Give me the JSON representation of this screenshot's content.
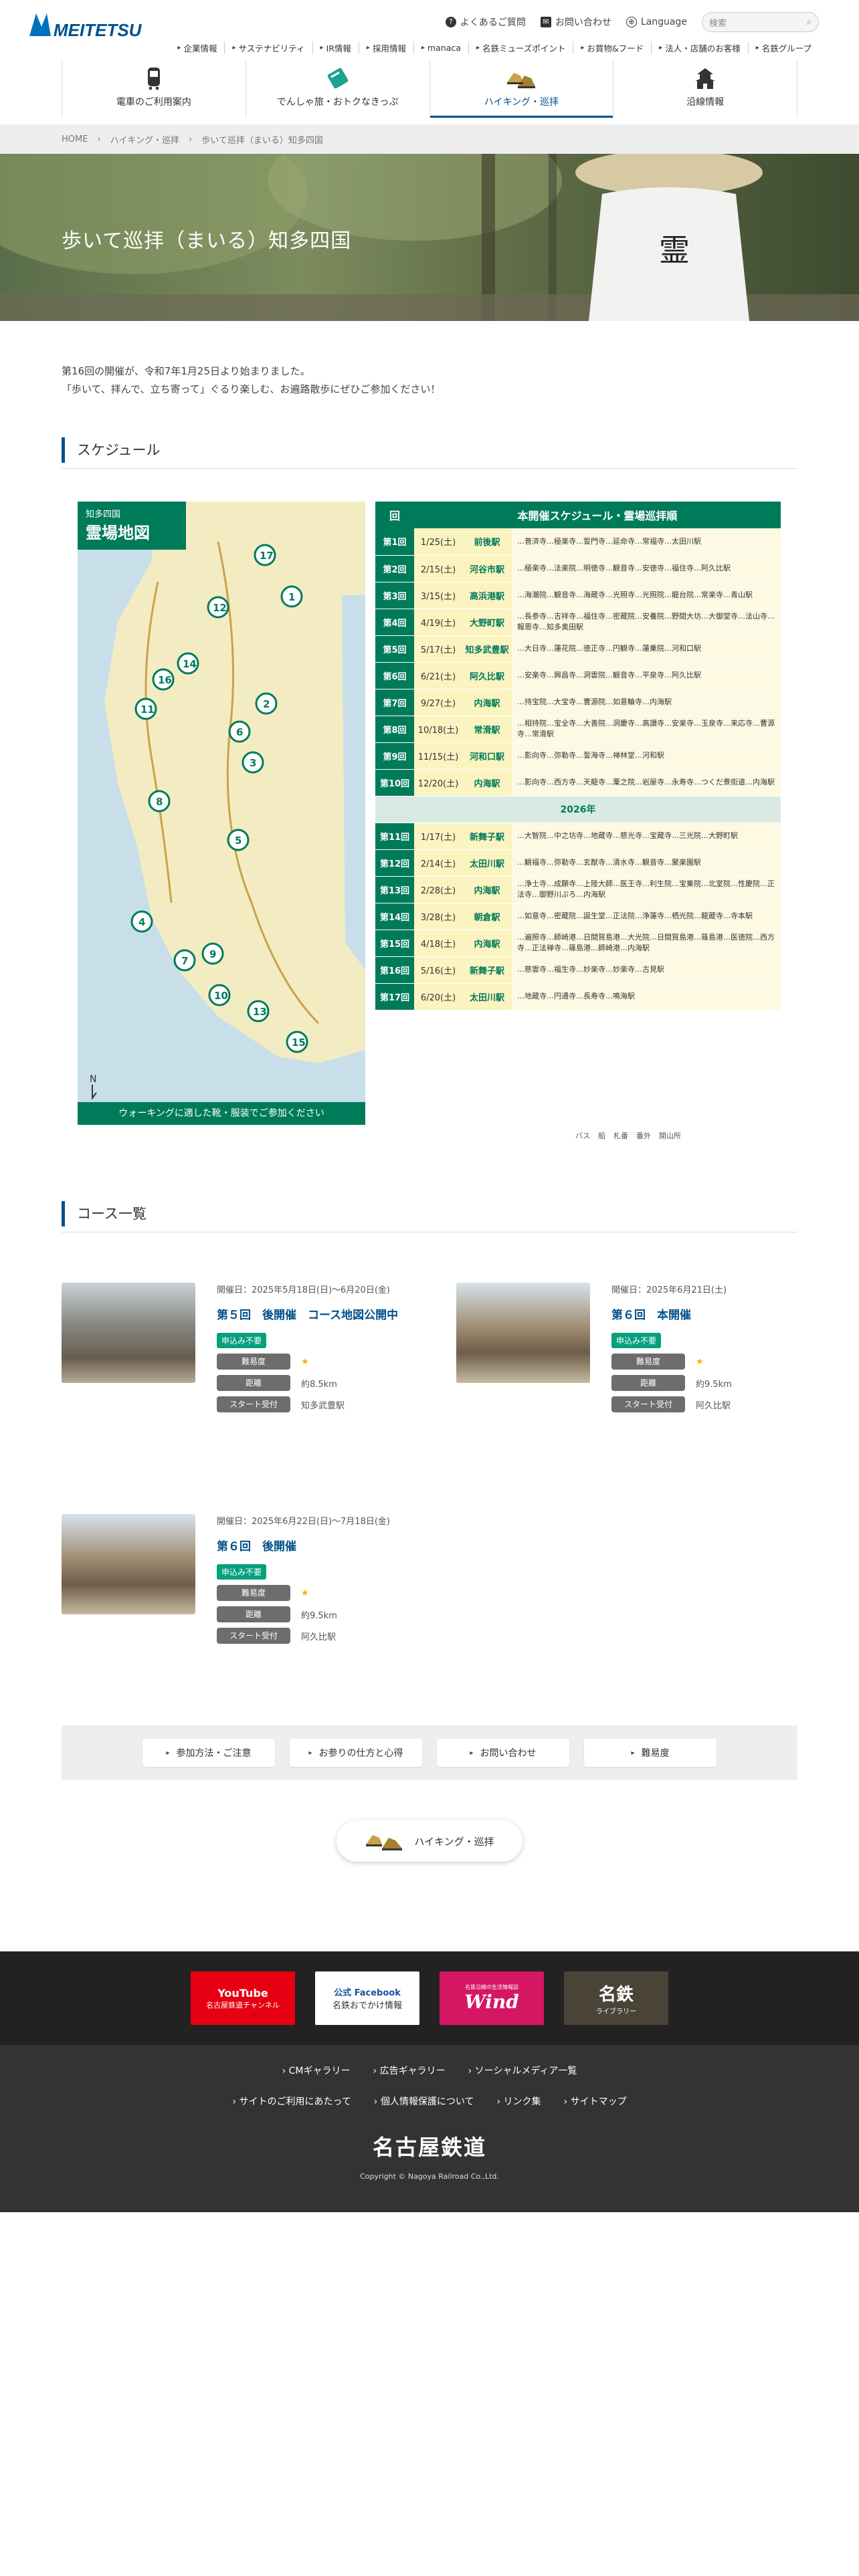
{
  "header": {
    "logo_text": "MEITETSU",
    "util": [
      {
        "icon": "question-icon",
        "label": "よくあるご質問"
      },
      {
        "icon": "mail-icon",
        "label": "お問い合わせ"
      },
      {
        "icon": "globe-icon",
        "label": "Language"
      }
    ],
    "search_placeholder": "検索",
    "sublinks": [
      "企業情報",
      "サステナビリティ",
      "IR情報",
      "採用情報",
      "manaca",
      "名鉄ミューズポイント",
      "お買物&フード",
      "法人・店舗のお客様",
      "名鉄グループ"
    ],
    "gnav": [
      {
        "label": "電車のご利用案内",
        "icon": "train-icon"
      },
      {
        "label": "でんしゃ旅・おトクなきっぷ",
        "icon": "ticket-icon"
      },
      {
        "label": "ハイキング・巡拝",
        "icon": "shoes-icon"
      },
      {
        "label": "沿線情報",
        "icon": "castle-icon"
      }
    ]
  },
  "breadcrumb": [
    "HOME",
    "ハイキング・巡拝",
    "歩いて巡拝（まいる）知多四国"
  ],
  "hero_title": "歩いて巡拝（まいる）知多四国",
  "intro": [
    "第16回の開催が、令和7年1月25日より始まりました。",
    "「歩いて、拝んで、立ち寄って」ぐるり楽しむ、お遍路散歩にぜひご参加ください！"
  ],
  "schedule": {
    "section_title": "スケジュール",
    "map_title_1": "知多四国",
    "map_title_2": "霊場地図",
    "map_footer": "ウォーキングに適した靴・服装でご参加ください",
    "table_head_no": "回",
    "table_head_title": "本開催スケジュール・霊場巡拝順",
    "year_row": "2026年",
    "rows": [
      {
        "no": "第1回",
        "date": "1/25(土)",
        "station": "前後駅",
        "route": "…普済寺…極楽寺…誓門寺…延命寺…常福寺…太田川駅"
      },
      {
        "no": "第2回",
        "date": "2/15(土)",
        "station": "河谷市駅",
        "route": "…極楽寺…法楽院…明徳寺…観音寺…安徳寺…福住寺…阿久比駅"
      },
      {
        "no": "第3回",
        "date": "3/15(土)",
        "station": "高浜港駅",
        "route": "…海潮院…観音寺…海蔵寺…光照寺…光照院…龍台院…常楽寺…青山駅"
      },
      {
        "no": "第4回",
        "date": "4/19(土)",
        "station": "大野町駅",
        "route": "…長参寺…吉祥寺…福住寺…密蔵院…安養院…野間大坊…大御堂寺…法山寺…報恩寺…知多奥田駅"
      },
      {
        "no": "第5回",
        "date": "5/17(土)",
        "station": "知多武豊駅",
        "route": "…大日寺…蓮花院…徳正寺…円観寺…蓮乗院…河和口駅"
      },
      {
        "no": "第6回",
        "date": "6/21(土)",
        "station": "阿久比駅",
        "route": "…安楽寺…興昌寺…洞雲院…観音寺…平泉寺…阿久比駅"
      },
      {
        "no": "第7回",
        "date": "9/27(土)",
        "station": "内海駅",
        "route": "…持宝院…大宝寺…曹源院…如意輪寺…内海駅"
      },
      {
        "no": "第8回",
        "date": "10/18(土)",
        "station": "常滑駅",
        "route": "…相持院…宝全寺…大善院…洞慶寺…高讃寺…安楽寺…玉泉寺…来応寺…曹源寺…常滑駅"
      },
      {
        "no": "第9回",
        "date": "11/15(土)",
        "station": "河和口駅",
        "route": "…影向寺…弥勒寺…誓海寺…禅林堂…河和駅"
      },
      {
        "no": "第10回",
        "date": "12/20(土)",
        "station": "内海駅",
        "route": "…影向寺…西方寺…天龍寺…粟之院…岩屋寺…永寿寺…つくだ煮街道…内海駅"
      },
      {
        "no": "第11回",
        "date": "1/17(土)",
        "station": "新舞子駅",
        "route": "…大智院…中之坊寺…地蔵寺…慈光寺…宝蔵寺…三光院…大野町駅"
      },
      {
        "no": "第12回",
        "date": "2/14(土)",
        "station": "太田川駅",
        "route": "…観福寺…弥勒寺…玄猷寺…清水寺…観音寺…聚楽園駅"
      },
      {
        "no": "第13回",
        "date": "2/28(土)",
        "station": "内海駅",
        "route": "…浄土寺…成願寺…上陸大師…医王寺…利生院…宝乗院…北室院…性慶院…正法寺…御野川ぷろ…内海駅"
      },
      {
        "no": "第14回",
        "date": "3/28(土)",
        "station": "朝倉駅",
        "route": "…如意寺…密蔵院…誕生堂…正法院…浄蓮寺…栖光院…龍蔵寺…寺本駅"
      },
      {
        "no": "第15回",
        "date": "4/18(土)",
        "station": "内海駅",
        "route": "…遍照寺…師崎港…日間賀島港…大光院…日間賀島港…篠島港…医徳院…西方寺…正法禅寺…篠島港…師崎港…内海駅"
      },
      {
        "no": "第16回",
        "date": "5/16(土)",
        "station": "新舞子駅",
        "route": "…慈雲寺…福生寺…妙楽寺…妙楽寺…古見駅"
      },
      {
        "no": "第17回",
        "date": "6/20(土)",
        "station": "太田川駅",
        "route": "…地蔵寺…円通寺…長寿寺…鳴海駅"
      }
    ],
    "legend": [
      "バス",
      "船",
      "札番",
      "番外",
      "開山所"
    ]
  },
  "courses": {
    "section_title": "コース一覧",
    "label_difficulty": "難易度",
    "label_distance": "距離",
    "label_start": "スタート受付",
    "items": [
      {
        "date": "開催日：2025年5月18日(日)〜6月20日(金)",
        "title": "第５回　後開催　コース地図公開中",
        "badge": "申込み不要",
        "stars": "★",
        "distance": "約8.5km",
        "start": "知多武豊駅"
      },
      {
        "date": "開催日：2025年6月21日(土)",
        "title": "第６回　本開催",
        "badge": "申込み不要",
        "stars": "★",
        "distance": "約9.5km",
        "start": "阿久比駅"
      },
      {
        "date": "開催日：2025年6月22日(日)〜7月18日(金)",
        "title": "第６回　後開催",
        "badge": "申込み不要",
        "stars": "★",
        "distance": "約9.5km",
        "start": "阿久比駅"
      }
    ]
  },
  "bottom_links": [
    "参加方法・ご注意",
    "お参りの仕方と心得",
    "お問い合わせ",
    "難易度"
  ],
  "hike_button": "ハイキング・巡拝",
  "footer": {
    "banners": [
      {
        "line1": "YouTube",
        "line2": "名古屋鉄道チャンネル"
      },
      {
        "line1": "公式 Facebook",
        "line2": "名鉄おでかけ情報"
      },
      {
        "line1": "Wind",
        "line2": "名鉄沿線の生活情報誌"
      },
      {
        "line1": "名鉄",
        "line2": "ライブラリー"
      }
    ],
    "links_row1": [
      "CMギャラリー",
      "広告ギャラリー",
      "ソーシャルメディア一覧"
    ],
    "links_row2": [
      "サイトのご利用にあたって",
      "個人情報保護について",
      "リンク集",
      "サイトマップ"
    ],
    "brand": "名古屋鉄道",
    "copyright": "Copyright © Nagoya Railroad Co.,Ltd."
  },
  "colors": {
    "brand": "#00508c",
    "green": "#007b5a",
    "badge": "#07a07d"
  }
}
